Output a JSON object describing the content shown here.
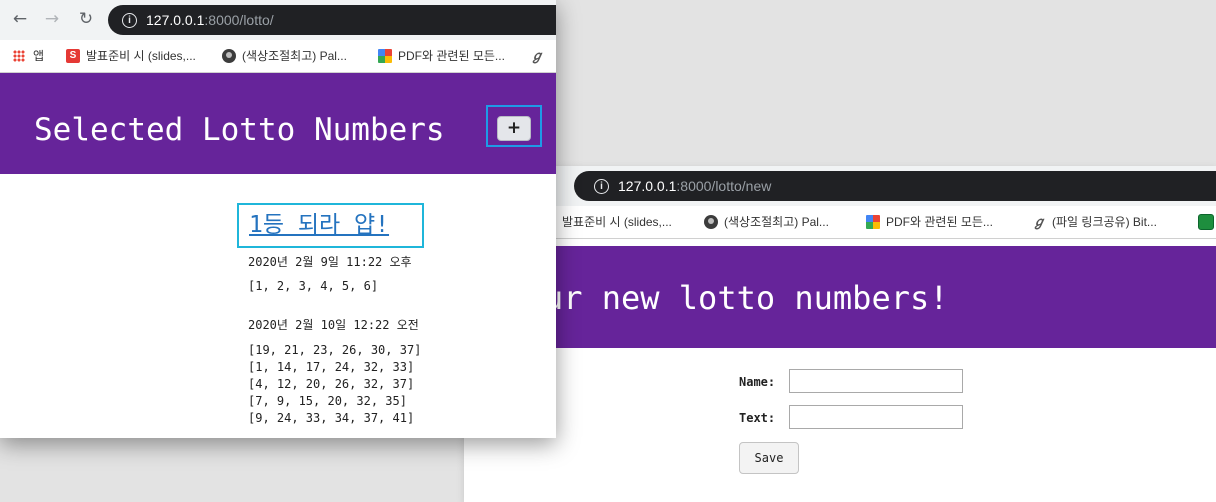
{
  "window_list": {
    "url_host": "127.0.0.1",
    "url_rest": ":8000/lotto/",
    "bookmarks": [
      "앱",
      "발표준비 시 (slides,...",
      "(색상조절최고) Pal...",
      "PDF와 관련된 모든..."
    ],
    "heading": "Selected Lotto Numbers",
    "add_button": "+",
    "post": {
      "title": "1등 되라 얍!",
      "entries": [
        {
          "date": "2020년 2월 9일 11:22 오후",
          "numbers": [
            "[1, 2, 3, 4, 5, 6]"
          ]
        },
        {
          "date": "2020년 2월 10일 12:22 오전",
          "numbers": [
            "[19, 21, 23, 26, 30, 37]",
            "[1, 14, 17, 24, 32, 33]",
            "[4, 12, 20, 26, 32, 37]",
            "[7, 9, 15, 20, 32, 35]",
            "[9, 24, 33, 34, 37, 41]"
          ]
        }
      ]
    }
  },
  "window_new": {
    "url_host": "127.0.0.1",
    "url_rest": ":8000/lotto/new",
    "bookmarks": [
      "발표준비 시 (slides,...",
      "(색상조절최고) Pal...",
      "PDF와 관련된 모든...",
      "(파일 링크공유) Bit..."
    ],
    "heading": "Generate your new lotto numbers!",
    "form": {
      "name_label": "Name:",
      "name_value": "",
      "text_label": "Text:",
      "text_value": "",
      "save_button": "Save"
    }
  },
  "colors": {
    "banner": "#66249a",
    "link": "#2473bf",
    "highlight_frame": "#1fb6da"
  }
}
